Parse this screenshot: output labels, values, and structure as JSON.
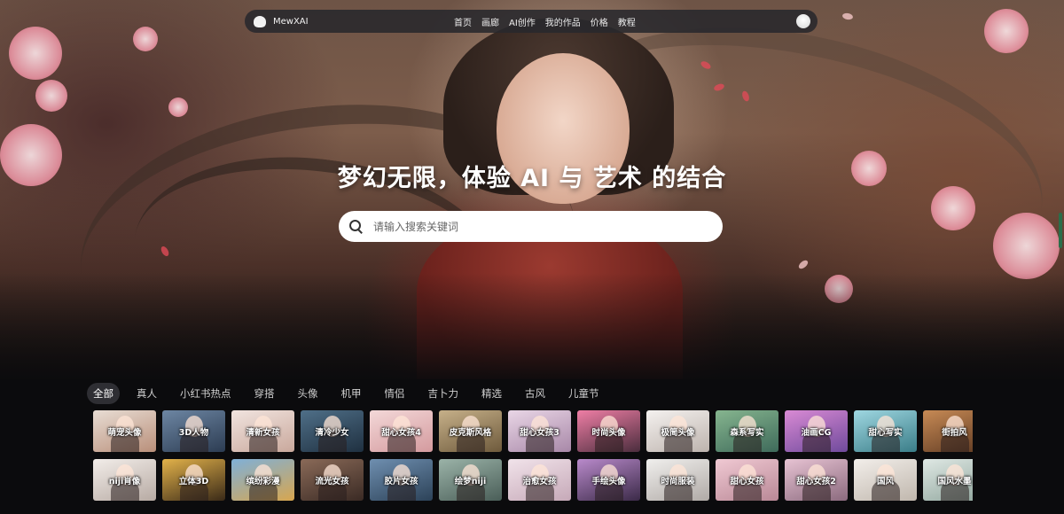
{
  "nav": {
    "logo_text": "MewXAI",
    "menu": [
      "首页",
      "画廊",
      "AI创作",
      "我的作品",
      "价格",
      "教程"
    ]
  },
  "hero": {
    "headline": "梦幻无限，体验 AI 与 艺术 的结合",
    "search_placeholder": "请输入搜索关键词"
  },
  "categories": [
    "全部",
    "真人",
    "小红书热点",
    "穿搭",
    "头像",
    "机甲",
    "情侣",
    "吉卜力",
    "精选",
    "古风",
    "儿童节"
  ],
  "active_category": "全部",
  "styles_row1": [
    "萌宠头像",
    "3D人物",
    "清新女孩",
    "清冷少女",
    "甜心女孩4",
    "皮克斯风格",
    "甜心女孩3",
    "时尚头像",
    "极简头像",
    "森系写实",
    "油画CG",
    "甜心写实",
    "街拍风"
  ],
  "styles_row2": [
    "niji肖像",
    "立体3D",
    "缤纷彩漫",
    "流光女孩",
    "胶片女孩",
    "绘梦niji",
    "治愈女孩",
    "手绘头像",
    "时尚服装",
    "甜心女孩",
    "甜心女孩2",
    "国风",
    "国风水墨"
  ],
  "colors": {
    "nav_bg": "#28282c",
    "page_bg": "#0b0b0d",
    "active_chip": "#2e2e33"
  }
}
